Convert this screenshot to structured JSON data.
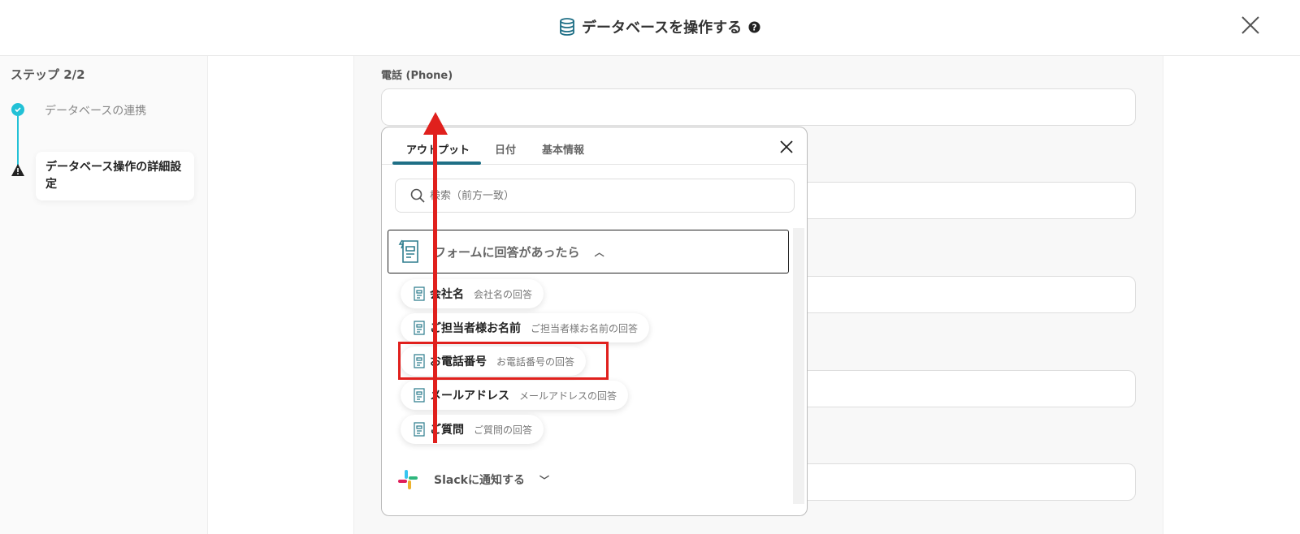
{
  "header": {
    "title": "データベースを操作する",
    "icon": "database-icon",
    "help_icon": "question-circle-icon",
    "close_icon": "close-icon"
  },
  "sidebar": {
    "step_heading": "ステップ 2/2",
    "steps": [
      {
        "label": "データベースの連携",
        "status": "completed"
      },
      {
        "label": "データベース操作の詳細設定",
        "status": "warning"
      }
    ]
  },
  "main": {
    "field_label": "電話 (Phone)",
    "field_value": ""
  },
  "popup": {
    "tabs": [
      {
        "label": "アウトプット",
        "active": true
      },
      {
        "label": "日付"
      },
      {
        "label": "基本情報"
      }
    ],
    "search_placeholder": "検索（前方一致）",
    "group": {
      "label": "フォームに回答があったら",
      "expanded": true
    },
    "items": [
      {
        "name": "会社名",
        "desc": "会社名の回答"
      },
      {
        "name": "ご担当者様お名前",
        "desc": "ご担当者様お名前の回答"
      },
      {
        "name": "お電話番号",
        "desc": "お電話番号の回答",
        "highlighted": true
      },
      {
        "name": "メールアドレス",
        "desc": "メールアドレスの回答"
      },
      {
        "name": "ご質問",
        "desc": "ご質問の回答"
      }
    ],
    "group2": {
      "label": "Slackに通知する",
      "expanded": false
    }
  },
  "colors": {
    "accent": "#1f6f86",
    "step": "#22c1d6",
    "annotation": "#e0201d"
  }
}
